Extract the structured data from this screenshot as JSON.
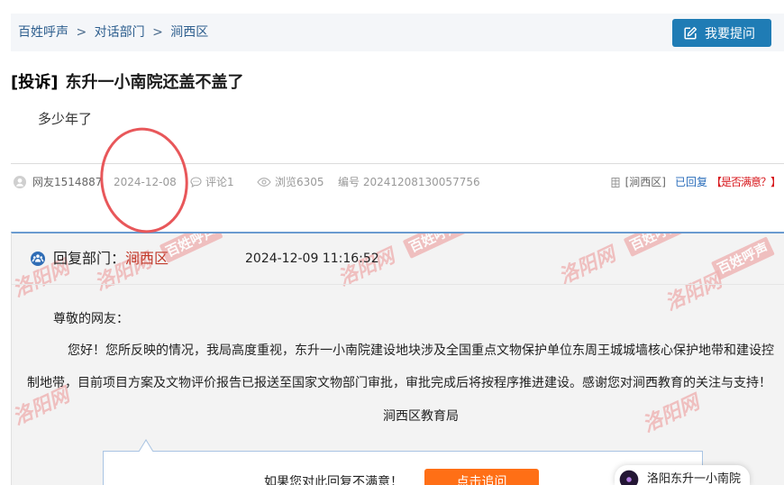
{
  "breadcrumb": {
    "items": [
      "百姓呼声",
      "对话部门",
      "涧西区"
    ],
    "separator": ">"
  },
  "ask_button": {
    "label": "我要提问",
    "icon": "edit-icon"
  },
  "post": {
    "tag": "[投诉]",
    "title": "东升一小南院还盖不盖了",
    "content": "多少年了"
  },
  "meta": {
    "user_icon": "user-icon",
    "user": "网友1514887",
    "date": "2024-12-08",
    "comments_icon": "comment-icon",
    "comments": "评论1",
    "views_icon": "eye-icon",
    "views": "浏览6305",
    "number": "编号 20241208130057756",
    "district_icon": "building-icon",
    "district": "[涧西区]",
    "status": "已回复",
    "satisfaction": "【是否满意？】"
  },
  "reply": {
    "dept_icon": "department-icon",
    "dept_label": "回复部门：",
    "dept_name": "涧西区",
    "time": "2024-12-09 11:16:52",
    "greeting": "尊敬的网友：",
    "body": "您好！您所反映的情况，我局高度重视，东升一小南院建设地块涉及全国重点文物保护单位东周王城城墙核心保护地带和建设控制地带，目前项目方案及文物评价报告已报送至国家文物部门审批，审批完成后将按程序推进建设。感谢您对涧西教育的关注与支持！",
    "signature": "涧西区教育局"
  },
  "followup": {
    "prompt": "如果您对此回复不满意！",
    "button_label": "点击追问"
  },
  "floating_badge": {
    "avatar_icon": "avatar-icon",
    "label": "洛阳东升一小南院"
  },
  "watermark": {
    "site": "洛阳网",
    "stamp": "百姓呼声"
  },
  "colors": {
    "breadcrumb_bg": "#f4f6f9",
    "link": "#2d5e8e",
    "separator": "#4a6b8c",
    "button": "#1f7cb5",
    "dept_name": "#c23b2c",
    "replied": "#2a6dbb",
    "satisfaction": "#d7161b",
    "reply_bg": "#f3f3f3",
    "reply_border": "#6a9bd0",
    "followup_border": "#a9c4e3",
    "followup_button": "#ff6f16",
    "annotation": "#e8575a",
    "watermark": "#efb3b3"
  }
}
